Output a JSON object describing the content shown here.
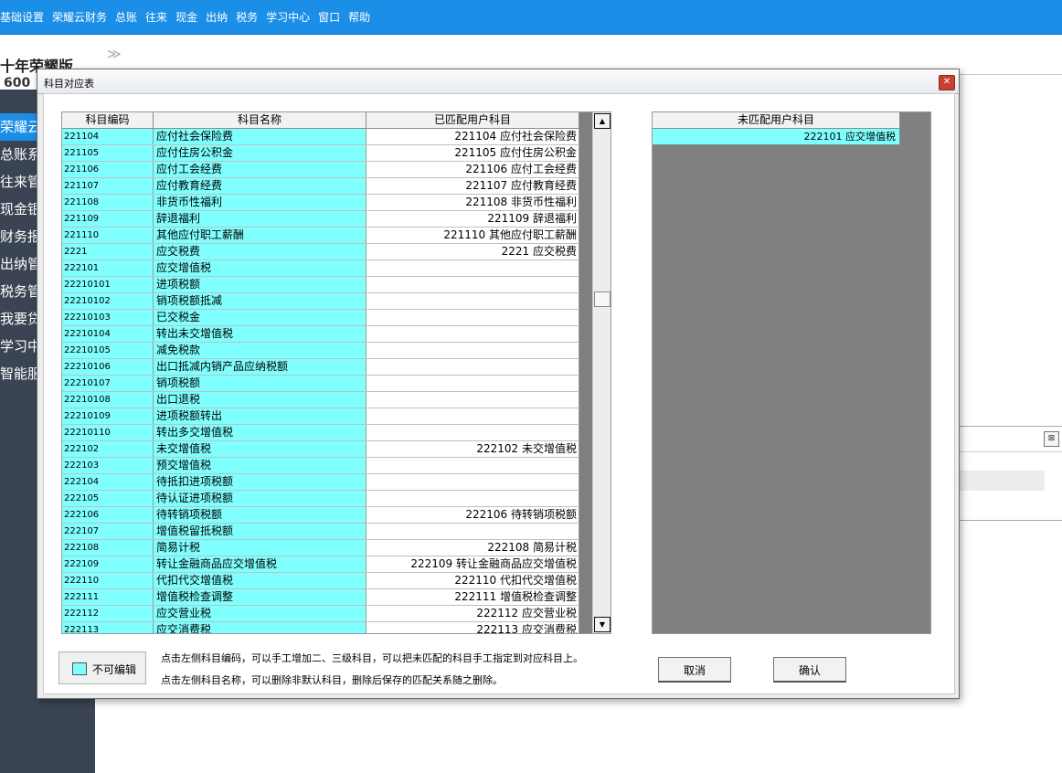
{
  "menubar": {
    "items": [
      "基础设置",
      "荣耀云财务",
      "总账",
      "往来",
      "现金",
      "出纳",
      "税务",
      "学习中心",
      "窗口",
      "帮助"
    ]
  },
  "sidebar": {
    "brand_title": "十年荣耀版",
    "brand_sub": "600",
    "items": [
      "荣耀云",
      "总账系",
      "往来管",
      "现金银",
      "财务报",
      "出纳管",
      "税务管",
      "我要贷",
      "学习中",
      "智能服"
    ]
  },
  "breadcrumb": {
    "icon": "double-chevron-right-icon",
    "glyph": "≫"
  },
  "dialog": {
    "title": "科目对应表",
    "close_glyph": "✕",
    "left_table": {
      "headers": [
        "科目编码",
        "科目名称",
        "已匹配用户科目"
      ],
      "rows": [
        {
          "code": "221104",
          "name": "应付社会保险费",
          "match": "221104 应付社会保险费"
        },
        {
          "code": "221105",
          "name": "应付住房公积金",
          "match": "221105 应付住房公积金"
        },
        {
          "code": "221106",
          "name": "应付工会经费",
          "match": "221106 应付工会经费"
        },
        {
          "code": "221107",
          "name": "应付教育经费",
          "match": "221107 应付教育经费"
        },
        {
          "code": "221108",
          "name": "非货币性福利",
          "match": "221108 非货币性福利"
        },
        {
          "code": "221109",
          "name": "辞退福利",
          "match": "221109 辞退福利"
        },
        {
          "code": "221110",
          "name": "其他应付职工薪酬",
          "match": "221110 其他应付职工薪酬"
        },
        {
          "code": "2221",
          "name": "应交税费",
          "match": "2221 应交税费"
        },
        {
          "code": "222101",
          "name": "应交增值税",
          "match": ""
        },
        {
          "code": "22210101",
          "name": "进项税额",
          "match": ""
        },
        {
          "code": "22210102",
          "name": "销项税额抵减",
          "match": ""
        },
        {
          "code": "22210103",
          "name": "已交税金",
          "match": ""
        },
        {
          "code": "22210104",
          "name": "转出未交增值税",
          "match": ""
        },
        {
          "code": "22210105",
          "name": "减免税款",
          "match": ""
        },
        {
          "code": "22210106",
          "name": "出口抵减内销产品应纳税额",
          "match": ""
        },
        {
          "code": "22210107",
          "name": "销项税额",
          "match": ""
        },
        {
          "code": "22210108",
          "name": "出口退税",
          "match": ""
        },
        {
          "code": "22210109",
          "name": "进项税额转出",
          "match": ""
        },
        {
          "code": "22210110",
          "name": "转出多交增值税",
          "match": ""
        },
        {
          "code": "222102",
          "name": "未交增值税",
          "match": "222102 未交增值税"
        },
        {
          "code": "222103",
          "name": "预交增值税",
          "match": ""
        },
        {
          "code": "222104",
          "name": "待抵扣进项税额",
          "match": ""
        },
        {
          "code": "222105",
          "name": "待认证进项税额",
          "match": ""
        },
        {
          "code": "222106",
          "name": "待转销项税额",
          "match": "222106 待转销项税额"
        },
        {
          "code": "222107",
          "name": "增值税留抵税额",
          "match": ""
        },
        {
          "code": "222108",
          "name": "简易计税",
          "match": "222108 简易计税"
        },
        {
          "code": "222109",
          "name": "转让金融商品应交增值税",
          "match": "222109 转让金融商品应交增值税"
        },
        {
          "code": "222110",
          "name": "代扣代交增值税",
          "match": "222110 代扣代交增值税"
        },
        {
          "code": "222111",
          "name": "增值税检查调整",
          "match": "222111 增值税检查调整"
        },
        {
          "code": "222112",
          "name": "应交营业税",
          "match": "222112 应交营业税"
        },
        {
          "code": "222113",
          "name": "应交消费税",
          "match": "222113 应交消费税"
        }
      ],
      "scroll_up_glyph": "▲",
      "scroll_down_glyph": "▼"
    },
    "right_table": {
      "header": "未匹配用户科目",
      "rows": [
        "222101 应交增值税"
      ]
    },
    "legend_label": "不可编辑",
    "notes": [
      "点击左侧科目编码，可以手工增加二、三级科目，可以把未匹配的科目手工指定到对应科目上。",
      "点击左侧科目名称，可以删除非默认科目，删除后保存的匹配关系随之删除。"
    ],
    "cancel_label": "取消",
    "confirm_label": "确认"
  },
  "background_window": {
    "close_glyph": "⊠"
  },
  "colors": {
    "accent": "#1b8ee8",
    "sidebar": "#3b4453",
    "readonly_cell": "#80ffff"
  }
}
